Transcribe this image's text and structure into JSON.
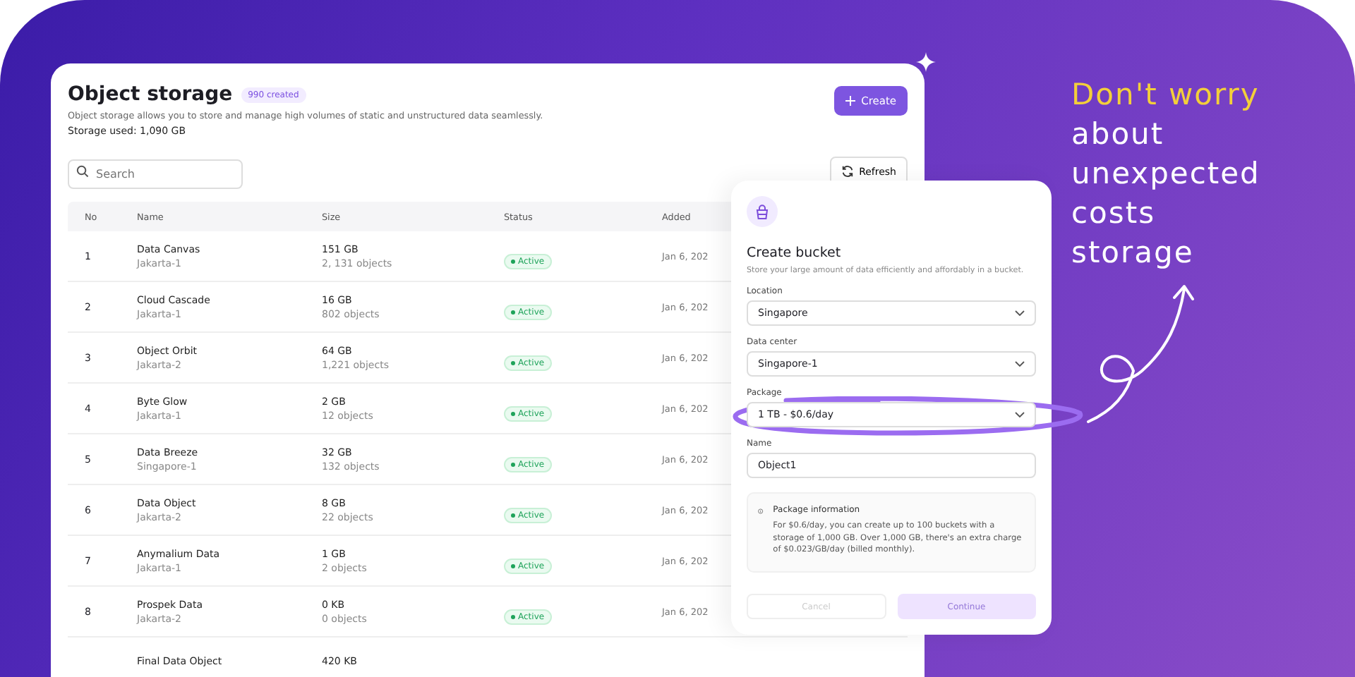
{
  "page": {
    "title": "Object storage",
    "badge": "990 created",
    "description": "Object storage allows you to store and manage high volumes of static and unstructured data seamlessly.",
    "storage_used": "Storage used: 1,090 GB",
    "create_button": "Create",
    "search": {
      "placeholder": "Search"
    },
    "refresh_button": "Refresh"
  },
  "table": {
    "columns": [
      "No",
      "Name",
      "Size",
      "Status",
      "Added"
    ],
    "rows": [
      {
        "no": "1",
        "name": "Data Canvas",
        "region": "Jakarta-1",
        "size": "151 GB",
        "objects": "2, 131 objects",
        "status": "Active",
        "added": "Jan 6, 202"
      },
      {
        "no": "2",
        "name": "Cloud Cascade",
        "region": "Jakarta-1",
        "size": "16 GB",
        "objects": "802 objects",
        "status": "Active",
        "added": "Jan 6, 202"
      },
      {
        "no": "3",
        "name": "Object Orbit",
        "region": "Jakarta-2",
        "size": "64 GB",
        "objects": "1,221 objects",
        "status": "Active",
        "added": "Jan 6, 202"
      },
      {
        "no": "4",
        "name": "Byte Glow",
        "region": "Jakarta-1",
        "size": "2 GB",
        "objects": "12 objects",
        "status": "Active",
        "added": "Jan 6, 202"
      },
      {
        "no": "5",
        "name": "Data Breeze",
        "region": "Singapore-1",
        "size": "32 GB",
        "objects": "132 objects",
        "status": "Active",
        "added": "Jan 6, 202"
      },
      {
        "no": "6",
        "name": "Data Object",
        "region": "Jakarta-2",
        "size": "8 GB",
        "objects": "22 objects",
        "status": "Active",
        "added": "Jan 6, 202"
      },
      {
        "no": "7",
        "name": "Anymalium Data",
        "region": "Jakarta-1",
        "size": "1 GB",
        "objects": "2 objects",
        "status": "Active",
        "added": "Jan 6, 202"
      },
      {
        "no": "8",
        "name": "Prospek Data",
        "region": "Jakarta-2",
        "size": "0 KB",
        "objects": "0 objects",
        "status": "Active",
        "added": "Jan 6, 202"
      },
      {
        "no": "",
        "name": "Final Data Object",
        "region": "",
        "size": "420 KB",
        "objects": "",
        "status": "",
        "added": ""
      }
    ]
  },
  "dialog": {
    "title": "Create bucket",
    "description": "Store your large amount of data efficiently and affordably in a bucket.",
    "fields": [
      {
        "kind": "select",
        "label": "Location",
        "value": "Singapore",
        "highlighted": false
      },
      {
        "kind": "select",
        "label": "Data center",
        "value": "Singapore-1",
        "highlighted": false
      },
      {
        "kind": "select",
        "label": "Package",
        "value": "1 TB - $0.6/day",
        "highlighted": true
      },
      {
        "kind": "text",
        "label": "Name",
        "value": "Object1",
        "highlighted": false
      }
    ],
    "info": {
      "title": "Package information",
      "text": "For $0.6/day, you can create up to 100 buckets with a storage of 1,000 GB. Over 1,000 GB, there's an extra charge of $0.023/GB/day (billed monthly)."
    },
    "buttons": [
      {
        "kind": "secondary",
        "label": "Cancel",
        "disabled": true
      },
      {
        "kind": "primary",
        "label": "Continue",
        "disabled": true
      }
    ]
  },
  "tagline": [
    {
      "text": "Don't worry",
      "accent": true
    },
    {
      "text": "about",
      "accent": false
    },
    {
      "text": "unexpected",
      "accent": false
    },
    {
      "text": "costs",
      "accent": false
    },
    {
      "text": "storage",
      "accent": false
    }
  ]
}
